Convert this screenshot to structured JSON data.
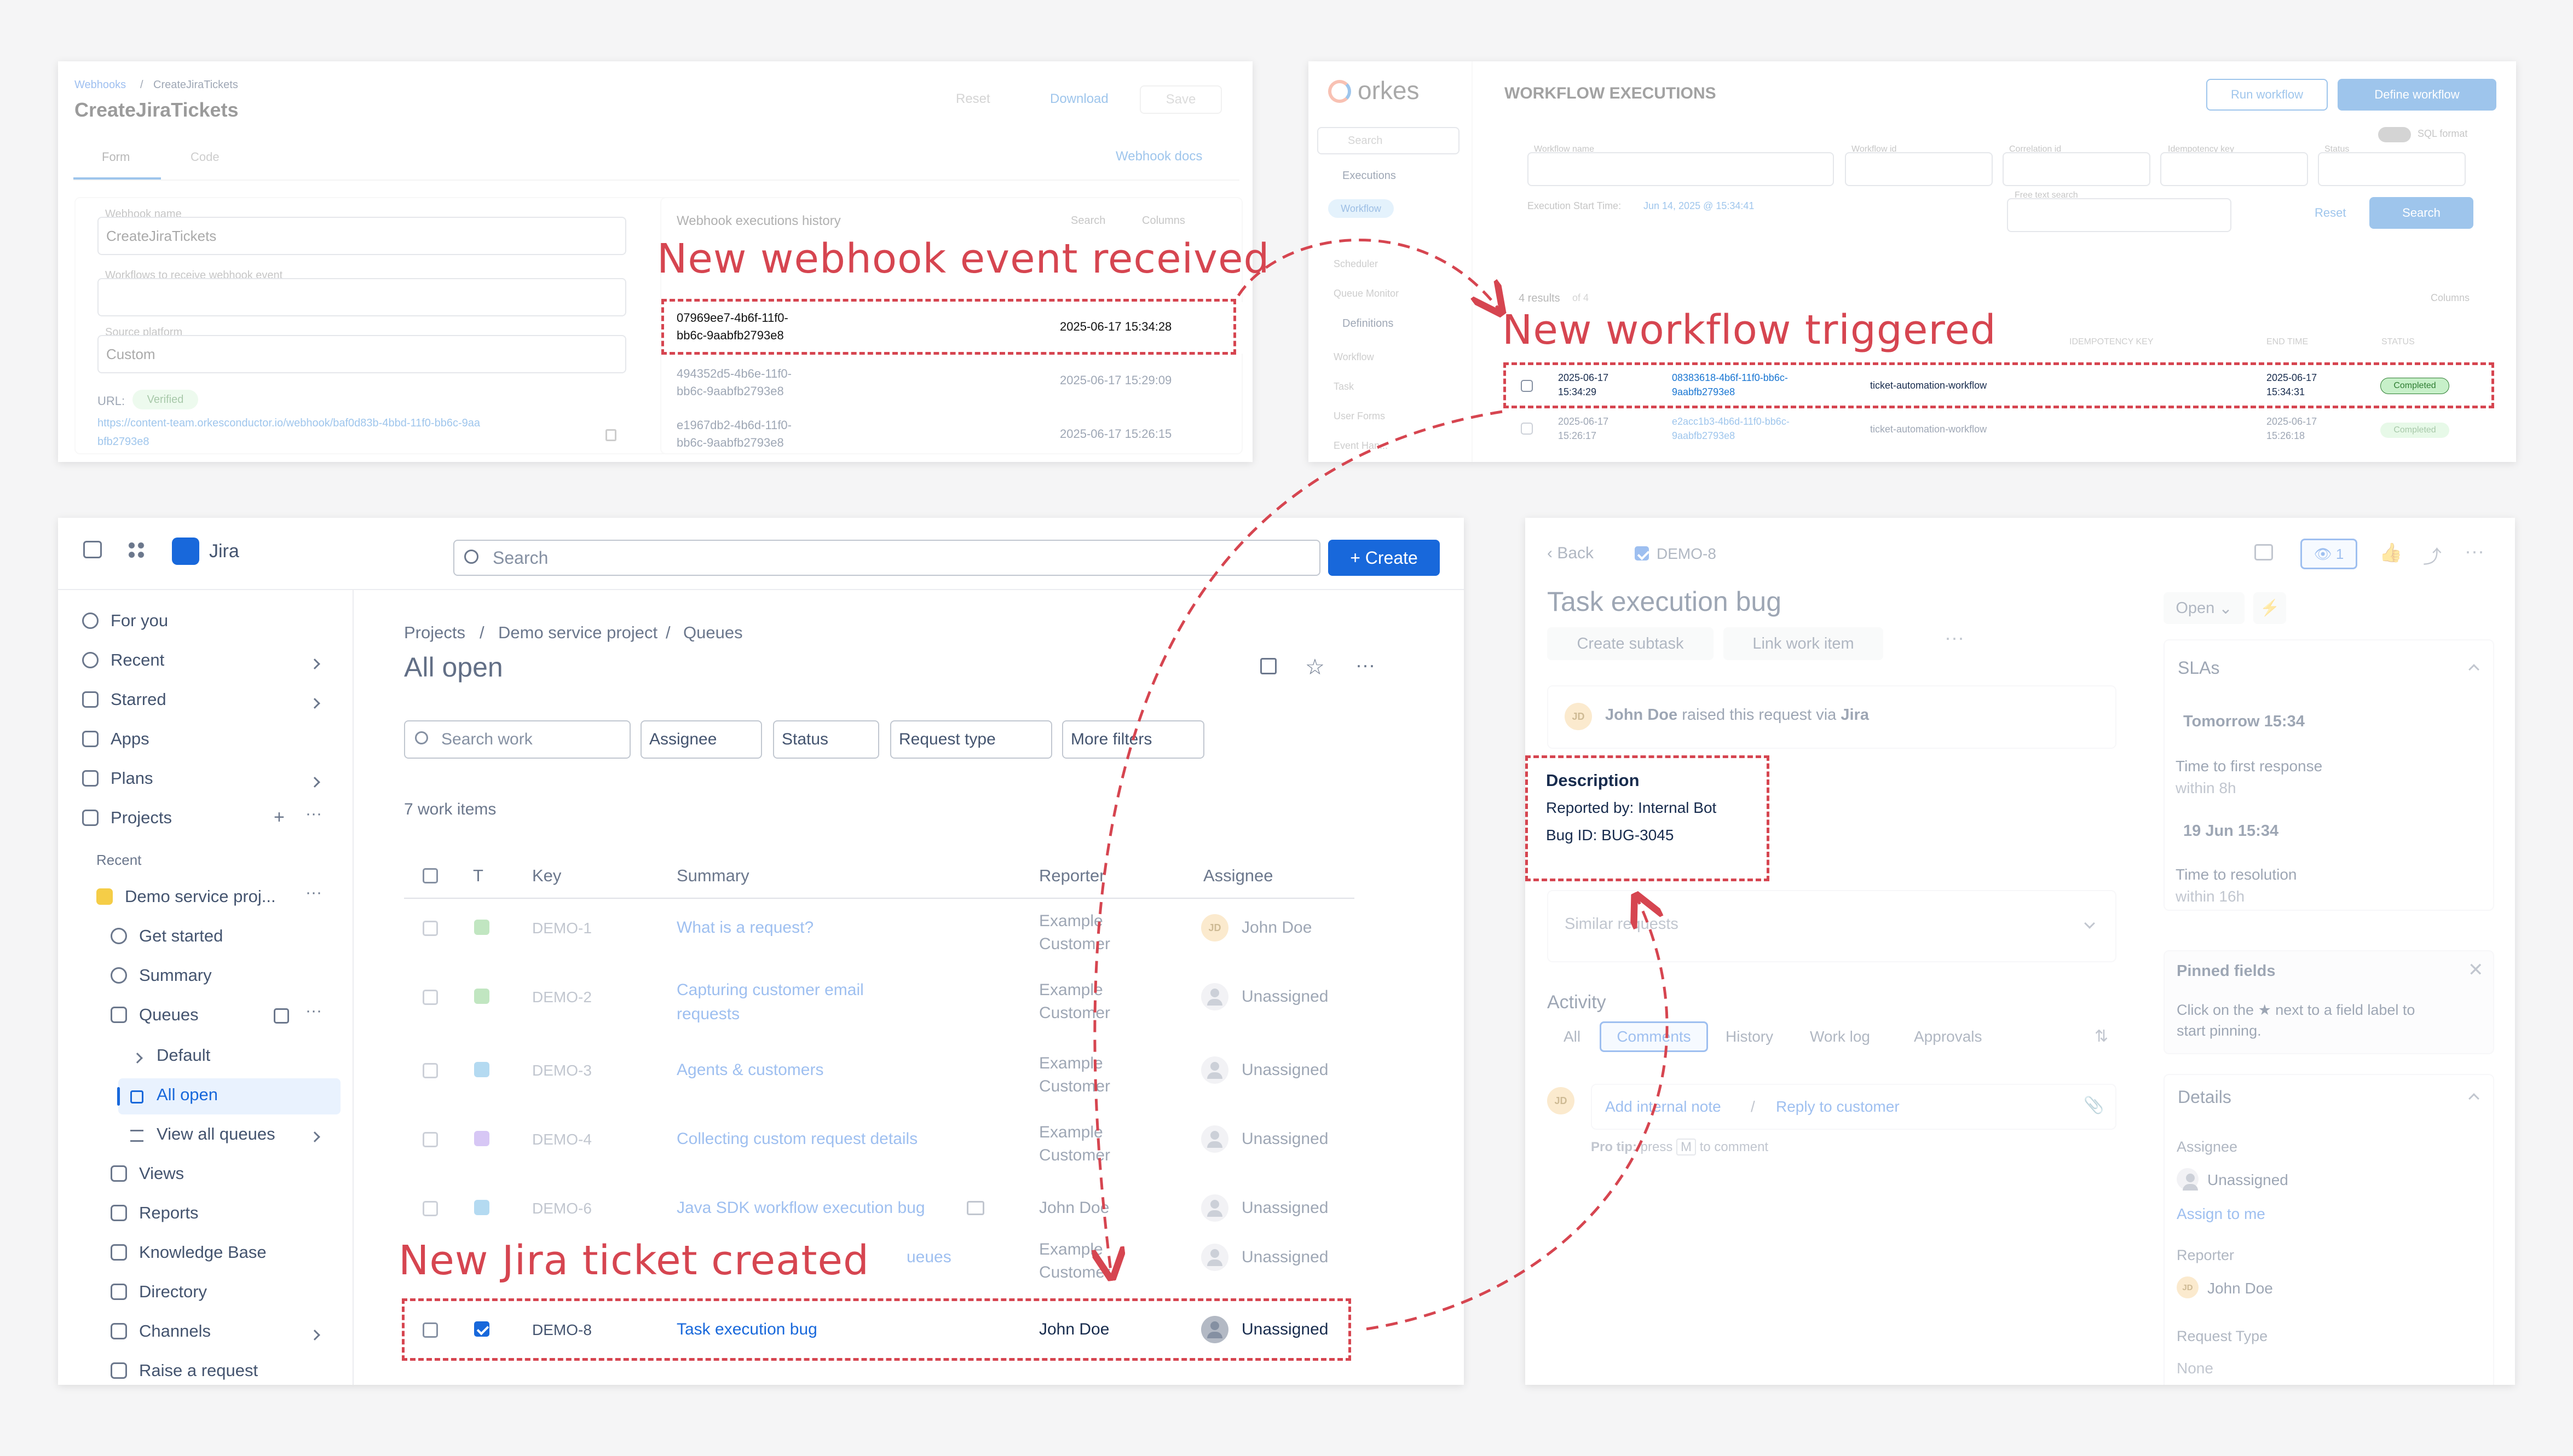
{
  "annotations": {
    "webhook_event": "New webhook event received",
    "workflow_triggered": "New workflow triggered",
    "jira_ticket": "New Jira ticket created"
  },
  "colors": {
    "annotation": "#d64550",
    "jira_blue": "#1868db",
    "orkes_blue": "#1976d2",
    "completed_green": "#c7f0c9"
  },
  "webhook": {
    "breadcrumb_parent": "Webhooks",
    "breadcrumb_sep": "/",
    "breadcrumb_current": "CreateJiraTickets",
    "title": "CreateJiraTickets",
    "reset_label": "Reset",
    "download_label": "Download",
    "save_label": "Save",
    "tab_form": "Form",
    "tab_code": "Code",
    "docs_link": "Webhook docs",
    "name_label": "Webhook name",
    "name_value": "CreateJiraTickets",
    "workflows_label": "Workflows to receive webhook event",
    "source_label": "Source platform",
    "source_value": "Custom",
    "url_label": "URL:",
    "verified": "Verified",
    "url_line1": "https://content-team.orkesconductor.io/webhook/baf0d83b-4bbd-11f0-bb6c-9aa",
    "url_line2": "bfb2793e8",
    "history_title": "Webhook executions history",
    "history_search": "Search",
    "history_columns": "Columns",
    "history": [
      {
        "id_line1": "07969ee7-4b6f-11f0-",
        "id_line2": "bb6c-9aabfb2793e8",
        "time": "2025-06-17 15:34:28"
      },
      {
        "id_line1": "494352d5-4b6e-11f0-",
        "id_line2": "bb6c-9aabfb2793e8",
        "time": "2025-06-17 15:29:09"
      },
      {
        "id_line1": "e1967db2-4b6d-11f0-",
        "id_line2": "bb6c-9aabfb2793e8",
        "time": "2025-06-17 15:26:15"
      }
    ]
  },
  "orkes": {
    "logo": "orkes",
    "search_placeholder": "Search",
    "nav_executions": "Executions",
    "nav_workflow": "Workflow",
    "nav_scheduler": "Scheduler",
    "nav_queue_monitor": "Queue Monitor",
    "nav_definitions": "Definitions",
    "nav_def_workflow": "Workflow",
    "nav_task": "Task",
    "nav_user_forms": "User Forms",
    "nav_event_handler": "Event Han...",
    "page_title": "WORKFLOW EXECUTIONS",
    "run_workflow": "Run workflow",
    "define_workflow": "Define workflow",
    "sql_format": "SQL format",
    "filter_workflow_name": "Workflow name",
    "filter_workflow_id": "Workflow id",
    "filter_correlation_id": "Correlation id",
    "filter_idempotency_key": "Idempotency key",
    "filter_status": "Status",
    "filter_free_text": "Free text search",
    "start_time_label": "Execution Start Time:",
    "start_time_value": "Jun 14, 2025 @ 15:34:41",
    "reset": "Reset",
    "search": "Search",
    "results": "4 results",
    "results_of": "of 4",
    "columns": "Columns",
    "col_idempotency": "IDEMPOTENCY KEY",
    "col_end_time": "END TIME",
    "col_status": "STATUS",
    "rows": [
      {
        "start_date": "2025-06-17",
        "start_time": "15:34:29",
        "id_line1": "08383618-4b6f-11f0-bb6c-",
        "id_line2": "9aabfb2793e8",
        "name": "ticket-automation-workflow",
        "end_date": "2025-06-17",
        "end_time": "15:34:31",
        "status": "Completed"
      },
      {
        "start_date": "2025-06-17",
        "start_time": "15:26:17",
        "id_line1": "e2acc1b3-4b6d-11f0-bb6c-",
        "id_line2": "9aabfb2793e8",
        "name": "ticket-automation-workflow",
        "end_date": "2025-06-17",
        "end_time": "15:26:18",
        "status": "Completed"
      }
    ]
  },
  "jira": {
    "app_name": "Jira",
    "search_placeholder": "Search",
    "create_label": "Create",
    "nav": {
      "for_you": "For you",
      "recent": "Recent",
      "starred": "Starred",
      "apps": "Apps",
      "plans": "Plans",
      "projects": "Projects",
      "recent_header": "Recent",
      "project_name": "Demo service proj...",
      "get_started": "Get started",
      "summary": "Summary",
      "queues": "Queues",
      "default": "Default",
      "all_open": "All open",
      "view_all_queues": "View all queues",
      "views": "Views",
      "reports": "Reports",
      "knowledge_base": "Knowledge Base",
      "directory": "Directory",
      "channels": "Channels",
      "raise_request": "Raise a request"
    },
    "breadcrumb": {
      "projects": "Projects",
      "project": "Demo service project",
      "queues": "Queues",
      "sep": "/"
    },
    "page_title": "All open",
    "search_work_placeholder": "Search work",
    "filters": {
      "assignee": "Assignee",
      "status": "Status",
      "request_type": "Request type",
      "more": "More filters"
    },
    "count": "7 work items",
    "columns": {
      "type": "T",
      "key": "Key",
      "summary": "Summary",
      "reporter": "Reporter",
      "assignee": "Assignee"
    },
    "rows": [
      {
        "key": "DEMO-1",
        "summary_l1": "What is a request?",
        "summary_l2": "",
        "rep_l1": "Example",
        "rep_l2": "Customer",
        "assignee": "John Doe",
        "initials": "JD",
        "type_color": "#6cc36c"
      },
      {
        "key": "DEMO-2",
        "summary_l1": "Capturing customer email",
        "summary_l2": "requests",
        "rep_l1": "Example",
        "rep_l2": "Customer",
        "assignee": "Unassigned",
        "initials": "",
        "type_color": "#6cc36c"
      },
      {
        "key": "DEMO-3",
        "summary_l1": "Agents & customers",
        "summary_l2": "",
        "rep_l1": "Example",
        "rep_l2": "Customer",
        "assignee": "Unassigned",
        "initials": "",
        "type_color": "#4ca8de"
      },
      {
        "key": "DEMO-4",
        "summary_l1": "Collecting custom request details",
        "summary_l2": "",
        "rep_l1": "Example",
        "rep_l2": "Customer",
        "assignee": "Unassigned",
        "initials": "",
        "type_color": "#9f7be8"
      },
      {
        "key": "DEMO-6",
        "summary_l1": "Java SDK workflow execution bug",
        "summary_l2": "",
        "rep_l1": "John Doe",
        "rep_l2": "",
        "assignee": "Unassigned",
        "initials": "",
        "type_color": "#4ca8de"
      },
      {
        "key": "",
        "summary_l1": "ueues",
        "summary_l2": "",
        "rep_l1": "Example",
        "rep_l2": "Customer",
        "assignee": "Unassigned",
        "initials": "",
        "type_color": ""
      },
      {
        "key": "DEMO-8",
        "summary_l1": "Task execution bug",
        "summary_l2": "",
        "rep_l1": "John Doe",
        "rep_l2": "",
        "assignee": "Unassigned",
        "initials": "",
        "type_color": "#1868db"
      }
    ]
  },
  "ticket": {
    "back": "Back",
    "key": "DEMO-8",
    "watchers": "1",
    "title": "Task execution bug",
    "create_subtask": "Create subtask",
    "link_work_item": "Link work item",
    "raised_by": "John Doe",
    "raised_text": "raised this request via",
    "raised_via": "Jira",
    "description_heading": "Description",
    "description_line1": "Reported by: Internal Bot",
    "description_line2": "Bug ID: BUG-3045",
    "similar_requests": "Similar requests",
    "activity": "Activity",
    "tabs": [
      "All",
      "Comments",
      "History",
      "Work log",
      "Approvals"
    ],
    "add_internal_note": "Add internal note",
    "reply_sep": "/",
    "reply_to_customer": "Reply to customer",
    "pro_tip_a": "Pro tip:",
    "pro_tip_b": "press",
    "pro_tip_key": "M",
    "pro_tip_c": "to comment",
    "status": "Open",
    "slas": "SLAs",
    "sla1_time": "Tomorrow 15:34",
    "sla1_label": "Time to first response",
    "sla1_within": "within 8h",
    "sla2_time": "19 Jun 15:34",
    "sla2_label": "Time to resolution",
    "sla2_within": "within 16h",
    "pinned_title": "Pinned fields",
    "pinned_text_l1": "Click on the ★ next to a field label to",
    "pinned_text_l2": "start pinning.",
    "details": "Details",
    "assignee_label": "Assignee",
    "assignee_value": "Unassigned",
    "assign_to_me": "Assign to me",
    "reporter_label": "Reporter",
    "reporter_value": "John Doe",
    "reporter_initials": "JD",
    "request_type_label": "Request Type",
    "request_type_value": "None"
  }
}
